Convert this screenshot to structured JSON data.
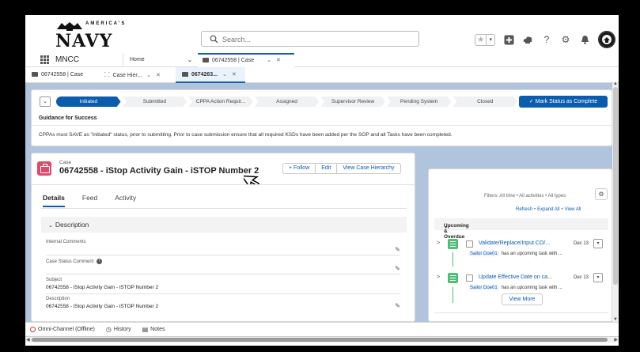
{
  "header": {
    "logo_small": "AMERICA'S",
    "logo_text": "NAVY",
    "search_placeholder": "Search...",
    "icons": [
      "star-icon",
      "add-icon",
      "cloud-icon",
      "help-icon",
      "gear-icon",
      "bell-icon",
      "avatar"
    ]
  },
  "appnav": {
    "app_name": "MNCC",
    "home_tab": "Home",
    "case_tab": "06742558 | Case",
    "case_tab_close": "✕",
    "case_tab_dd": "⌄"
  },
  "subtabs": [
    {
      "label": "06742558 | Case"
    },
    {
      "label": "Case Hier...",
      "dd": "⌄",
      "close": "✕"
    },
    {
      "label": "0674263...",
      "dd": "⌄",
      "close": "✕"
    }
  ],
  "path": {
    "steps": [
      "Initiated",
      "Submitted",
      "CPPA Action Requir...",
      "Assigned",
      "Supervisor Review",
      "Pending System",
      "Closed"
    ],
    "active_index": 0,
    "mark_button": "✓  Mark Status as Complete",
    "guidance_title": "Guidance for Success",
    "guidance_text": "CPPAs must SAVE as \"initiated\" status, prior to submitting. Prior to case submission ensure that all required KSDs have been added per the SOP and all Tasks have been completed."
  },
  "record": {
    "object_label": "Case",
    "title": "06742558 - iStop Activity Gain - iSTOP Number 2",
    "buttons": [
      "+  Follow",
      "Edit",
      "View Case Hierarchy"
    ],
    "tabs": [
      "Details",
      "Feed",
      "Activity"
    ],
    "section": "Description",
    "fields": [
      {
        "label": "Internal Comments",
        "value": ""
      },
      {
        "label": "Case Status Comment",
        "value": ""
      },
      {
        "label": "Subject",
        "value": "06742558 - iStop Activity Gain - iSTOP Number 2"
      },
      {
        "label": "Description",
        "value": "06742558 - iStop Activity Gain - iSTOP Number 2"
      }
    ]
  },
  "activity": {
    "filters": "Filters: All time • All activities • All types",
    "links": [
      "Refresh",
      "Expand All",
      "View All"
    ],
    "upcoming_label": "Upcoming & Overdue",
    "tasks": [
      {
        "title": "Validate/Replace/Input CO/...",
        "date": "Dec 13",
        "who": "Sailor Doe01",
        "sub": "has an upcoming task with ..."
      },
      {
        "title": "Update Effective Date on ca...",
        "date": "Dec 13",
        "who": "Sailor Doe01",
        "sub": "has an upcoming task with ..."
      }
    ],
    "view_more": "View More"
  },
  "utility": {
    "omni": "Omni-Channel (Offline)",
    "history": "History",
    "notes": "Notes"
  },
  "colors": {
    "brand_blue": "#0b5cad",
    "case_pink": "#e3466a",
    "task_green": "#4bc076",
    "page_bg": "#b0c4de"
  }
}
